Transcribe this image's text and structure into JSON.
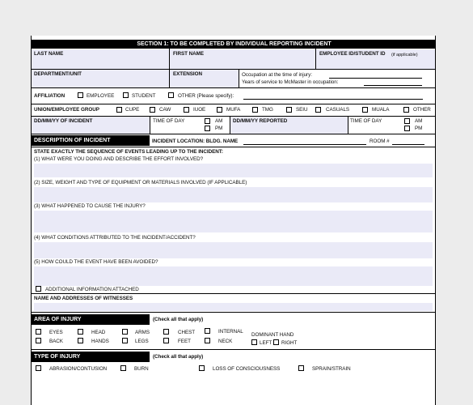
{
  "section_title": "SECTION 1: TO BE COMPLETED BY INDIVIDUAL REPORTING INCIDENT",
  "row1": {
    "last_name": "LAST NAME",
    "first_name": "FIRST NAME",
    "emp_id": "EMPLOYEE ID/STUDENT ID",
    "emp_id_note": "(if applicable)"
  },
  "row2": {
    "department": "DEPARTMENT/UNIT",
    "extension": "EXTENSION",
    "occupation_time": "Occupation at the time of injury:",
    "years_service": "Years of service to McMaster in occupation:"
  },
  "affiliation": {
    "label": "AFFILIATION",
    "employee": "EMPLOYEE",
    "student": "STUDENT",
    "other": "OTHER (Please specify):"
  },
  "union": {
    "label": "UNION/EMPLOYEE GROUP",
    "options": [
      "CUPE",
      "CAW",
      "IUOE",
      "MUFA",
      "TMG",
      "SEIU",
      "CASUALS",
      "MUALA",
      "OTHER"
    ]
  },
  "dates": {
    "incident_date": "DD/MM/YY OF INCIDENT",
    "time_of_day": "TIME OF DAY",
    "am": "AM",
    "pm": "PM",
    "reported_date": "DD/MM/YY REPORTED",
    "time_of_day2": "TIME OF DAY",
    "am2": "AM",
    "pm2": "PM"
  },
  "description": {
    "header": "DESCRIPTION OF INCIDENT",
    "location": "INCIDENT LOCATION: BLDG. NAME",
    "room": "ROOM #"
  },
  "questions": {
    "intro": "STATE EXACTLY THE SEQUENCE OF EVENTS LEADING UP TO THE INCIDENT:",
    "q1": "(1) WHAT WERE YOU DOING AND DESCRIBE THE EFFORT INVOLVED?",
    "q2": "(2) SIZE, WEIGHT AND TYPE OF EQUIPMENT OR MATERIALS INVOLVED (IF APPLICABLE)",
    "q3": "(3) WHAT HAPPENED TO CAUSE THE INJURY?",
    "q4": "(4) WHAT CONDITIONS ATTRIBUTED TO THE INCIDENT/ACCIDENT?",
    "q5": "(5) HOW COULD THE EVENT HAVE BEEN AVOIDED?",
    "additional": "ADDITIONAL INFORMATION ATTACHED"
  },
  "witnesses": "NAME AND ADDRESSES OF WITNESSES",
  "area": {
    "header": "AREA OF INJURY",
    "check_all": "(Check all that apply)",
    "items": [
      "EYES",
      "HEAD",
      "ARMS",
      "CHEST",
      "INTERNAL",
      "BACK",
      "HANDS",
      "LEGS",
      "FEET",
      "NECK"
    ],
    "dominant": "DOMINANT HAND",
    "left": "LEFT",
    "right": "RIGHT"
  },
  "type": {
    "header": "TYPE OF INJURY",
    "check_all": "(Check all that apply)",
    "items": [
      "ABRASION/CONTUSION",
      "BURN",
      "LOSS OF CONSCIOUSNESS",
      "SPRAIN/STRAIN"
    ]
  },
  "colors": {
    "field_fill": "#eaeaf7",
    "header_bg": "#000000"
  }
}
